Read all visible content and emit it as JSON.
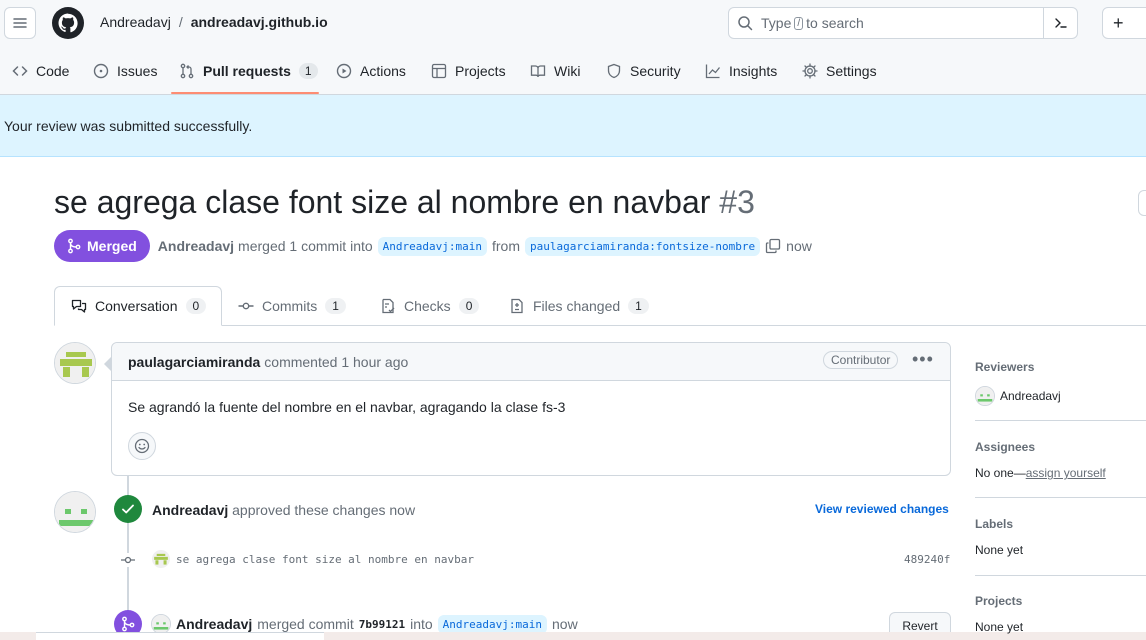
{
  "header": {
    "owner": "Andreadavj",
    "separator": "/",
    "repo": "andreadavj.github.io",
    "search_prefix": "Type",
    "search_key": "/",
    "search_suffix": "to search",
    "plus_label": "+"
  },
  "repo_nav": {
    "items": [
      {
        "label": "Code",
        "icon": "code-icon"
      },
      {
        "label": "Issues",
        "icon": "issue-opened-icon"
      },
      {
        "label": "Pull requests",
        "icon": "git-pull-request-icon",
        "counter": "1",
        "active": true
      },
      {
        "label": "Actions",
        "icon": "play-icon"
      },
      {
        "label": "Projects",
        "icon": "table-icon"
      },
      {
        "label": "Wiki",
        "icon": "book-icon"
      },
      {
        "label": "Security",
        "icon": "shield-icon"
      },
      {
        "label": "Insights",
        "icon": "graph-icon"
      },
      {
        "label": "Settings",
        "icon": "gear-icon"
      }
    ]
  },
  "flash": {
    "message": "Your review was submitted successfully."
  },
  "pr": {
    "title": "se agrega clase font size al nombre en navbar",
    "number": "#3",
    "state_label": "Merged",
    "author": "Andreadavj",
    "merged_text": "merged 1 commit into",
    "base_branch": "Andreadavj:main",
    "from_text": "from",
    "head_branch": "paulagarciamiranda:fontsize-nombre",
    "time": "now"
  },
  "tabs": [
    {
      "label": "Conversation",
      "counter": "0",
      "icon": "comment-discussion-icon",
      "active": true
    },
    {
      "label": "Commits",
      "counter": "1",
      "icon": "git-commit-icon"
    },
    {
      "label": "Checks",
      "counter": "0",
      "icon": "checklist-icon"
    },
    {
      "label": "Files changed",
      "counter": "1",
      "icon": "file-diff-icon"
    }
  ],
  "comment": {
    "author": "paulagarciamiranda",
    "action": "commented 1 hour ago",
    "role": "Contributor",
    "menu": "•••",
    "body": "Se agrandó la fuente del nombre en el navbar, agragando la clase fs-3"
  },
  "review": {
    "author": "Andreadavj",
    "action": "approved these changes now",
    "link": "View reviewed changes"
  },
  "commit": {
    "message": "se agrega clase font size al nombre en navbar",
    "sha": "489240f"
  },
  "merge_event": {
    "author": "Andreadavj",
    "text1": "merged commit",
    "sha": "7b99121",
    "text2": "into",
    "branch": "Andreadavj:main",
    "time": "now",
    "revert_label": "Revert"
  },
  "sidebar": {
    "reviewers_title": "Reviewers",
    "reviewer": "Andreadavj",
    "assignees_title": "Assignees",
    "assignees_none": "No one—",
    "assign_yourself": "assign yourself",
    "labels_title": "Labels",
    "labels_value": "None yet",
    "projects_title": "Projects",
    "projects_value": "None yet"
  },
  "colors": {
    "merged": "#8250df",
    "approved": "#1f883d",
    "link": "#0969da",
    "flash_bg": "#ddf4ff",
    "nav_underline": "#fd8c73"
  }
}
